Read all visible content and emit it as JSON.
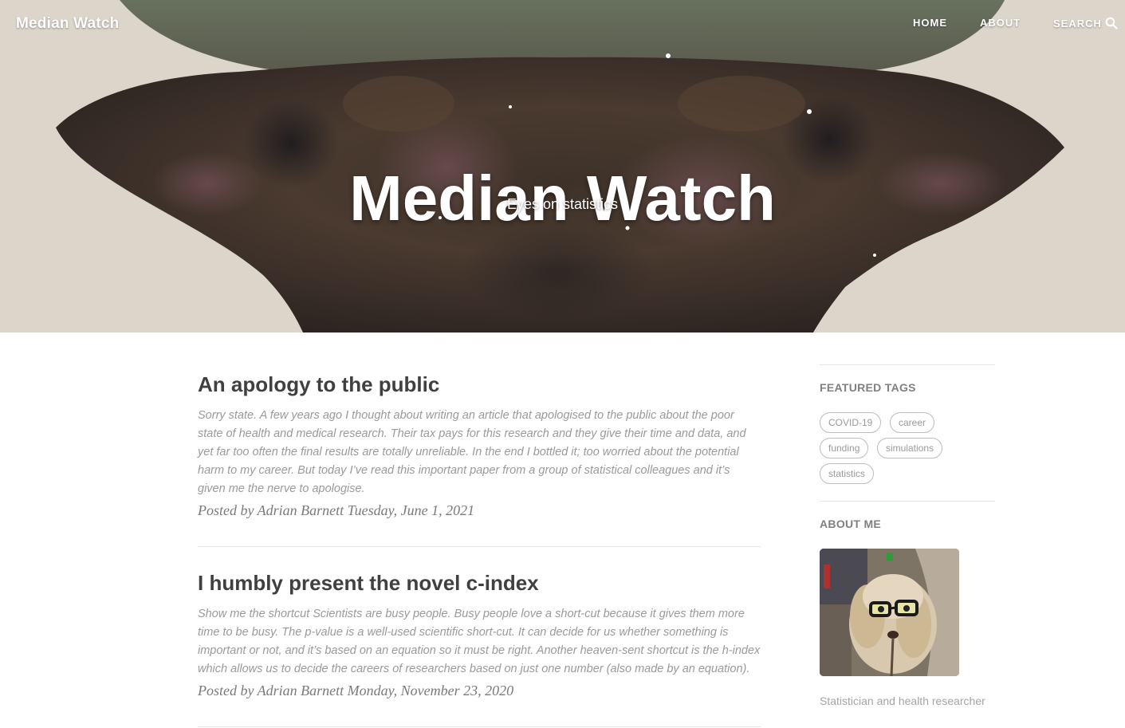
{
  "site": {
    "brand": "Median Watch",
    "title": "Median Watch",
    "subtitle": "Eyes on statistics"
  },
  "nav": {
    "items": [
      {
        "label": "HOME"
      },
      {
        "label": "ABOUT"
      },
      {
        "label": "SEARCH",
        "icon": "search-icon"
      }
    ]
  },
  "posts": [
    {
      "title": "An apology to the public",
      "excerpt": "Sorry state. A few years ago I thought about writing an article that apologised to the public about the poor state of health and medical research. Their tax pays for this research and they give their time and data, and yet far too often the final results are totally unreliable. In the end I bottled it; too worried about the potential harm to my career. But today I’ve read this important paper from a group of statistical colleagues and it’s given me the nerve to apologise.",
      "meta": "Posted by Adrian Barnett Tuesday, June 1, 2021"
    },
    {
      "title": "I humbly present the novel c-index",
      "excerpt": "Show me the shortcut Scientists are busy people. Busy people love a short-cut because it gives them more time to be busy. The p-value is a well-used scientific short-cut. It can decide for us whether something is important or not, and it’s based on an equation so it must be right. Another heaven-sent shortcut is the h-index which allows us to decide the careers of researchers based on just one number (also made by an equation).",
      "meta": "Posted by Adrian Barnett Monday, November 23, 2020"
    }
  ],
  "sidebar": {
    "featured_heading": "FEATURED TAGS",
    "tags": [
      "COVID-19",
      "career",
      "funding",
      "simulations",
      "statistics"
    ],
    "about_heading": "ABOUT ME",
    "about_text": "Statistician and health researcher"
  },
  "colors": {
    "heading": "#404040",
    "excerpt": "#9a9a9a",
    "meta": "#7a7a7a",
    "sidebar_heading": "#808080"
  }
}
